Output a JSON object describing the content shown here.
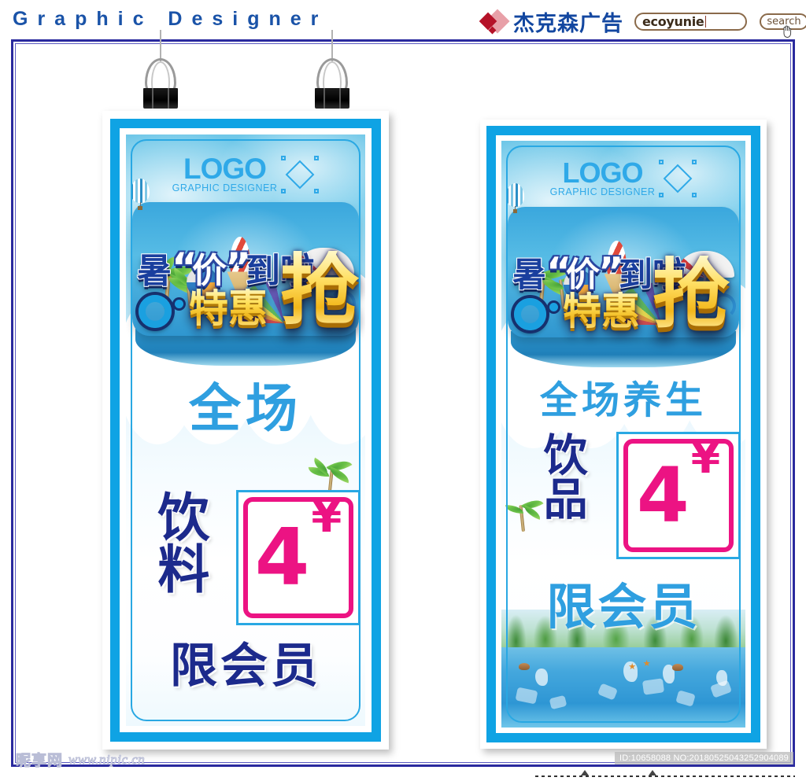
{
  "header": {
    "site_title": "Graphic  Designer",
    "brand_name": "杰克森广告",
    "brand_icon": "diamond-logo-icon",
    "search": {
      "value": "ecoyunie",
      "placeholder": "",
      "button_label": "search",
      "icon": "search-icon",
      "cursor": "hand-cursor-icon"
    }
  },
  "posters": [
    {
      "id": "poster-left",
      "logo": {
        "title": "LOGO",
        "subtitle": "GRAPHIC DESIGNER",
        "mark": "diamond-outline-icon"
      },
      "headline": {
        "line1_a": "暑",
        "line1_quote_open": "“",
        "line1_b": "价",
        "line1_quote_close": "”",
        "line1_c": "到啦",
        "line2": "特惠",
        "grab": "抢"
      },
      "subhead": "全场",
      "category": "饮料",
      "price": {
        "number": "4",
        "currency": "¥"
      },
      "footer_text": "限会员",
      "decor": [
        "hot-air-balloon",
        "palm-tree",
        "beach-umbrella",
        "ice-cream-cone",
        "beach-ball",
        "rainbow",
        "water-splash"
      ]
    },
    {
      "id": "poster-right",
      "logo": {
        "title": "LOGO",
        "subtitle": "GRAPHIC DESIGNER",
        "mark": "diamond-outline-icon"
      },
      "headline": {
        "line1_a": "暑",
        "line1_quote_open": "“",
        "line1_b": "价",
        "line1_quote_close": "”",
        "line1_c": "到啦",
        "line2": "特惠",
        "grab": "抢"
      },
      "subhead": "全场养生",
      "category": "饮品",
      "price": {
        "number": "4",
        "currency": "¥"
      },
      "footer_text": "限会员",
      "decor": [
        "hot-air-balloon",
        "palm-tree",
        "beach-umbrella",
        "ice-cream-cone",
        "beach-ball",
        "rainbow",
        "lake-scene",
        "water-splash"
      ]
    }
  ],
  "hanging_clips": {
    "count": 2,
    "icon": "binder-clip-icon"
  },
  "watermark": {
    "site_cn": "昵享网",
    "url": "www.nipic.cn"
  },
  "id_badge": "ID:10658088 NO:20180525043252904089",
  "colors": {
    "accent_blue": "#0fa3e4",
    "deep_navy": "#1c2a8c",
    "price_magenta": "#ec1383",
    "gold": "#ffd733",
    "header_blue": "#1a53a8",
    "brand_red": "#b51228",
    "frame_navy": "#2a2a9e"
  }
}
